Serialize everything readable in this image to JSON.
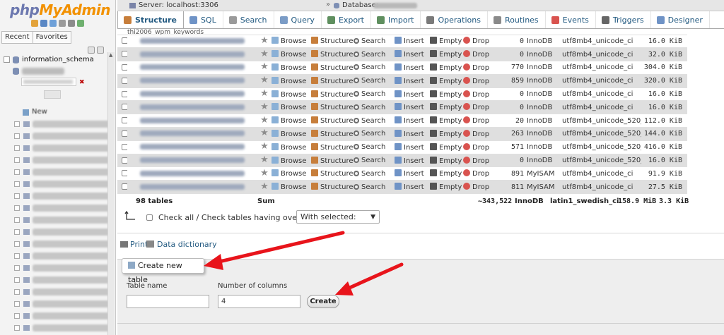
{
  "app": {
    "logo_php": "php",
    "logo_admin": "MyAdmin"
  },
  "sidebar": {
    "tabs": [
      "Recent",
      "Favorites"
    ],
    "info_schema": "information_schema",
    "new_label": "New"
  },
  "breadcrumb": {
    "server": "Server: localhost:3306",
    "separator": "»",
    "database_label": "Database:"
  },
  "tabs": [
    {
      "label": "Structure",
      "icon": "structure-icon",
      "color": "#c77e3b"
    },
    {
      "label": "SQL",
      "icon": "sql-icon",
      "color": "#6f93c6"
    },
    {
      "label": "Search",
      "icon": "search-icon",
      "color": "#9a9a9a"
    },
    {
      "label": "Query",
      "icon": "query-icon",
      "color": "#7b9cc6"
    },
    {
      "label": "Export",
      "icon": "export-icon",
      "color": "#5f8f5f"
    },
    {
      "label": "Import",
      "icon": "import-icon",
      "color": "#5f8f5f"
    },
    {
      "label": "Operations",
      "icon": "operations-icon",
      "color": "#7a7a7a"
    },
    {
      "label": "Routines",
      "icon": "routines-icon",
      "color": "#8a8a8a"
    },
    {
      "label": "Events",
      "icon": "events-icon",
      "color": "#d9534f"
    },
    {
      "label": "Triggers",
      "icon": "triggers-icon",
      "color": "#666666"
    },
    {
      "label": "Designer",
      "icon": "designer-icon",
      "color": "#6f93c6"
    }
  ],
  "actions": {
    "browse": "Browse",
    "structure": "Structure",
    "search": "Search",
    "insert": "Insert",
    "empty": "Empty",
    "drop": "Drop"
  },
  "first_row_partial": "thi2006_wpm_keywords",
  "rows": [
    {
      "rows": "0",
      "type": "InnoDB",
      "collation": "utf8mb4_unicode_ci",
      "size": "16.0 KiB",
      "overhead": "-"
    },
    {
      "rows": "0",
      "type": "InnoDB",
      "collation": "utf8mb4_unicode_ci",
      "size": "32.0 KiB",
      "overhead": "-"
    },
    {
      "rows": "770",
      "type": "InnoDB",
      "collation": "utf8mb4_unicode_ci",
      "size": "304.0 KiB",
      "overhead": "-"
    },
    {
      "rows": "859",
      "type": "InnoDB",
      "collation": "utf8mb4_unicode_ci",
      "size": "320.0 KiB",
      "overhead": "-"
    },
    {
      "rows": "0",
      "type": "InnoDB",
      "collation": "utf8mb4_unicode_ci",
      "size": "16.0 KiB",
      "overhead": "-"
    },
    {
      "rows": "0",
      "type": "InnoDB",
      "collation": "utf8mb4_unicode_ci",
      "size": "16.0 KiB",
      "overhead": "-"
    },
    {
      "rows": "20",
      "type": "InnoDB",
      "collation": "utf8mb4_unicode_520_ci",
      "size": "112.0 KiB",
      "overhead": "-"
    },
    {
      "rows": "263",
      "type": "InnoDB",
      "collation": "utf8mb4_unicode_520_ci",
      "size": "144.0 KiB",
      "overhead": "-"
    },
    {
      "rows": "571",
      "type": "InnoDB",
      "collation": "utf8mb4_unicode_520_ci",
      "size": "416.0 KiB",
      "overhead": "-"
    },
    {
      "rows": "0",
      "type": "InnoDB",
      "collation": "utf8mb4_unicode_520_ci",
      "size": "16.0 KiB",
      "overhead": "-"
    },
    {
      "rows": "891",
      "type": "MyISAM",
      "collation": "utf8mb4_unicode_ci",
      "size": "91.9 KiB",
      "overhead": "-"
    },
    {
      "rows": "811",
      "type": "MyISAM",
      "collation": "utf8mb4_unicode_ci",
      "size": "27.5 KiB",
      "overhead": "-"
    }
  ],
  "summary": {
    "tables": "98 tables",
    "sum": "Sum",
    "rows": "~343,522",
    "type": "InnoDB",
    "collation": "latin1_swedish_ci",
    "size": "158.9 MiB",
    "overhead": "3.3 KiB"
  },
  "checkall": {
    "label": "Check all / Check tables having overhead",
    "with_selected": "With selected:"
  },
  "links": {
    "print": "Print",
    "data_dictionary": "Data dictionary"
  },
  "create": {
    "legend": "Create new table",
    "table_name_label": "Table name",
    "table_name_value": "",
    "num_columns_label": "Number of columns",
    "num_columns_value": "4",
    "button": "Create"
  },
  "colors": {
    "brand_blue": "#6c78af",
    "brand_orange": "#f29100",
    "link": "#235a81",
    "row_alt": "#dfdfdf",
    "arrow_red": "#e8141b"
  }
}
